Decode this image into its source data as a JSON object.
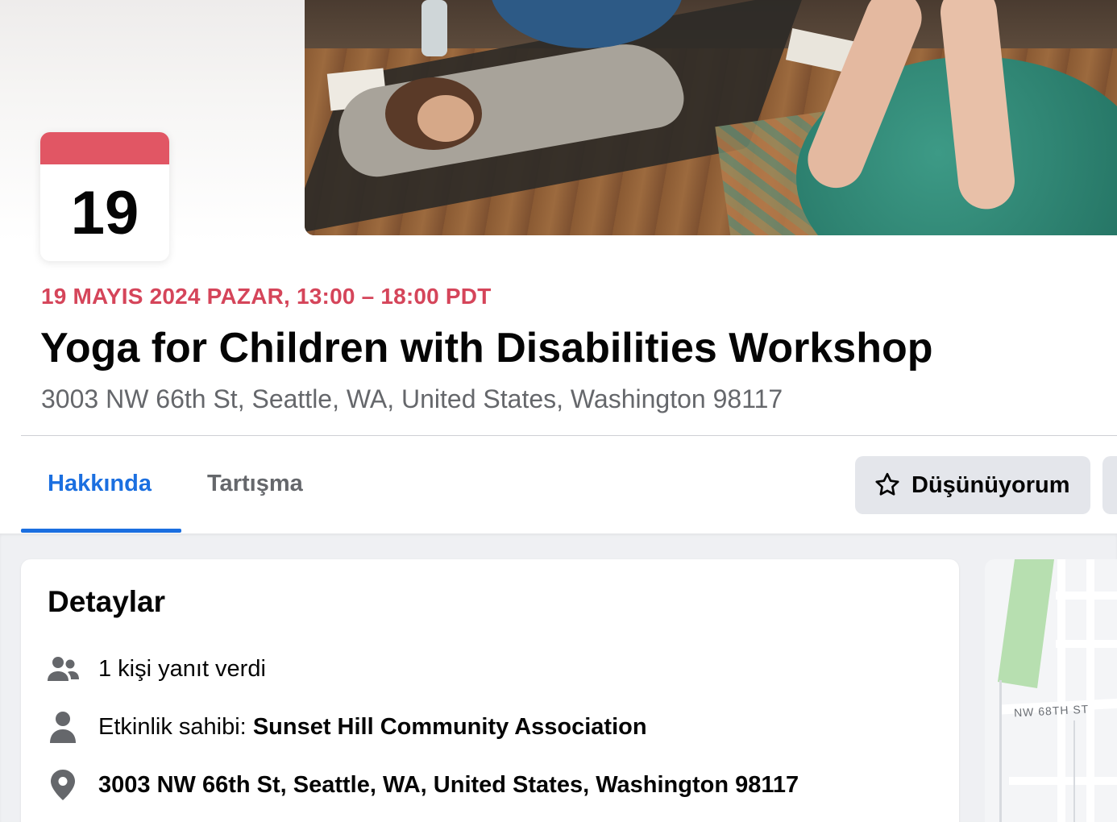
{
  "calendar": {
    "day": "19"
  },
  "event": {
    "date_line": "19 MAYIS 2024 PAZAR, 13:00 – 18:00 PDT",
    "title": "Yoga for Children with Disabilities Workshop",
    "address": "3003 NW 66th St, Seattle, WA, United States, Washington 98117"
  },
  "tabs": [
    {
      "label": "Hakkında",
      "active": true
    },
    {
      "label": "Tartışma",
      "active": false
    }
  ],
  "actions": {
    "interested_label": "Düşünüyorum",
    "interested_icon": "star-outline-icon"
  },
  "details": {
    "heading": "Detaylar",
    "responded": "1 kişi yanıt verdi",
    "host_prefix": "Etkinlik sahibi: ",
    "host_name": "Sunset Hill Community Association",
    "location": "3003 NW 66th St, Seattle, WA, United States, Washington 98117",
    "icons": [
      "people-icon",
      "person-icon",
      "location-pin-icon"
    ]
  },
  "map": {
    "street_label": "NW 68TH ST"
  },
  "colors": {
    "accent_blue": "#1b6fe0",
    "date_red": "#d5455a",
    "calendar_red": "#e15664",
    "secondary_text": "#65676b",
    "button_grey": "#e4e6eb"
  }
}
